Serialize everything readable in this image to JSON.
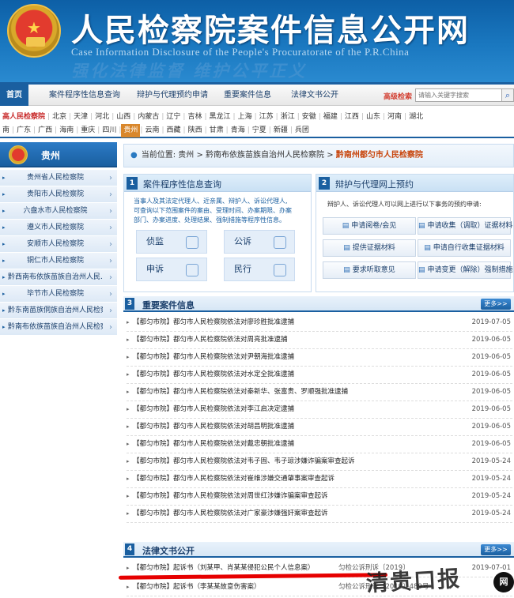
{
  "header": {
    "title": "人民检察院案件信息公开网",
    "subtitle": "Case Information Disclosure of the People's Procuratorate of the P.R.China",
    "slogan": "强化法律监督 维护公平正义"
  },
  "nav": {
    "items": [
      "首页",
      "案件程序性信息查询",
      "辩护与代理预约申请",
      "重要案件信息",
      "法律文书公开"
    ],
    "advanced_search": "高级检索",
    "search_placeholder": "请输入关键字搜索"
  },
  "regions_row1": [
    "高人民检察院",
    "北京",
    "天津",
    "河北",
    "山西",
    "内蒙古",
    "辽宁",
    "吉林",
    "黑龙江",
    "上海",
    "江苏",
    "浙江",
    "安徽",
    "福建",
    "江西",
    "山东",
    "河南",
    "湖北"
  ],
  "regions_row2": [
    "南",
    "广东",
    "广西",
    "海南",
    "重庆",
    "四川",
    "贵州",
    "云南",
    "西藏",
    "陕西",
    "甘肃",
    "青海",
    "宁夏",
    "新疆",
    "兵团"
  ],
  "sidebar": {
    "title": "贵州",
    "items": [
      "贵州省人民检察院",
      "贵阳市人民检察院",
      "六盘水市人民检察院",
      "遵义市人民检察院",
      "安顺市人民检察院",
      "铜仁市人民检察院",
      "黔西南布依族苗族自治州人民...",
      "毕节市人民检察院",
      "黔东南苗族侗族自治州人民检察院",
      "黔南布依族苗族自治州人民检察院"
    ]
  },
  "breadcrumb": {
    "prefix": "当前位置:",
    "level1": "贵州",
    "level2": "黔南布依族苗族自治州人民检察院",
    "current": "黔南州都匀市人民检察院",
    "sep": ">"
  },
  "panel1": {
    "num": "1",
    "title": "案件程序性信息查询",
    "desc": [
      "当事人及其法定代理人、近亲属、辩护人、诉讼代理人,",
      "可查询以下范围案件的案由、受理时间、办案期限、办案",
      "部门、办案进度、处理结果、强制措施等程序性信息。"
    ],
    "buttons": [
      "侦监",
      "公诉",
      "申诉",
      "民行"
    ]
  },
  "panel2": {
    "num": "2",
    "title": "辩护与代理网上预约",
    "desc": "辩护人、诉讼代理人可以网上进行以下事务的预约申请:",
    "buttons": [
      "申请阅卷/会见",
      "申请收集（调取）证据材料",
      "提供证据材料",
      "申请自行收集证据材料",
      "要求听取意见",
      "申请变更（解除）强制措施"
    ]
  },
  "section3": {
    "num": "3",
    "title": "重要案件信息",
    "more": "更多>>",
    "rows": [
      {
        "text": "【都匀市院】都匀市人民检察院依法对廖珍胜批准逮捕",
        "date": "2019-07-05"
      },
      {
        "text": "【都匀市院】都匀市人民检察院依法对周亮批准逮捕",
        "date": "2019-06-05"
      },
      {
        "text": "【都匀市院】都匀市人民检察院依法对尹朝海批准逮捕",
        "date": "2019-06-05"
      },
      {
        "text": "【都匀市院】都匀市人民检察院依法对水定全批准逮捕",
        "date": "2019-06-05"
      },
      {
        "text": "【都匀市院】都匀市人民检察院依法对秦新华、张富贵、罗顺强批准逮捕",
        "date": "2019-06-05"
      },
      {
        "text": "【都匀市院】都匀市人民检察院依法对李江启决定逮捕",
        "date": "2019-06-05"
      },
      {
        "text": "【都匀市院】都匀市人民检察院依法对胡昌明批准逮捕",
        "date": "2019-06-05"
      },
      {
        "text": "【都匀市院】都匀市人民检察院依法对戴忠朝批准逮捕",
        "date": "2019-06-05"
      },
      {
        "text": "【都匀市院】都匀市人民检察院依法对韦子固、韦子琼涉嫌诈骗案审查起诉",
        "date": "2019-05-24"
      },
      {
        "text": "【都匀市院】都匀市人民检察院依法对崔维涉嫌交通肇事案审查起诉",
        "date": "2019-05-24"
      },
      {
        "text": "【都匀市院】都匀市人民检察院依法对周世红涉嫌诈骗案审查起诉",
        "date": "2019-05-24"
      },
      {
        "text": "【都匀市院】都匀市人民检察院依法对广家豪涉嫌强奸案审查起诉",
        "date": "2019-05-24"
      }
    ]
  },
  "section4": {
    "num": "4",
    "title": "法律文书公开",
    "more": "更多>>",
    "rows": [
      {
        "text": "【都匀市院】起诉书（刘某甲、肖某某侵犯公民个人信息案）",
        "no": "匀检公诉刑诉〔2019〕",
        "date": "2019-07-01"
      },
      {
        "text": "【都匀市院】起诉书（李某某故意伤害案）",
        "no": "匀检公诉刑诉〔2019〕489号",
        "date": ""
      }
    ]
  },
  "watermark": {
    "text": "清贵口报",
    "logo": "网"
  },
  "colors": {
    "brand_blue": "#1a5fa0",
    "highlight_orange": "#d9872b",
    "red_underline": "#e60000"
  }
}
